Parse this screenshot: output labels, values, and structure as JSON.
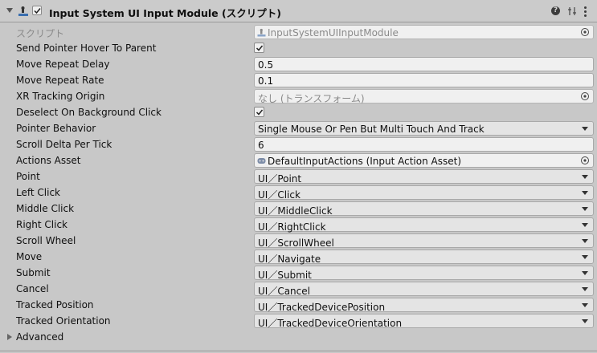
{
  "header": {
    "title": "Input System UI Input Module (スクリプト)",
    "enabled": true,
    "help_glyph": "?",
    "icons": [
      "component-icon",
      "help-icon",
      "preset-icon",
      "kebab-menu-icon"
    ]
  },
  "rows": [
    {
      "label": "スクリプト",
      "kind": "script",
      "value": "InputSystemUIInputModule"
    },
    {
      "label": "Send Pointer Hover To Parent",
      "kind": "toggle",
      "checked": true
    },
    {
      "label": "Move Repeat Delay",
      "kind": "text",
      "value": "0.5"
    },
    {
      "label": "Move Repeat Rate",
      "kind": "text",
      "value": "0.1"
    },
    {
      "label": "XR Tracking Origin",
      "kind": "object",
      "value": "なし (トランスフォーム)"
    },
    {
      "label": "Deselect On Background Click",
      "kind": "toggle",
      "checked": true
    },
    {
      "label": "Pointer Behavior",
      "kind": "popup",
      "value": "Single Mouse Or Pen But Multi Touch And Track"
    },
    {
      "label": "Scroll Delta Per Tick",
      "kind": "text",
      "value": "6"
    },
    {
      "label": "Actions Asset",
      "kind": "asset",
      "value": "DefaultInputActions (Input Action Asset)"
    },
    {
      "label": "Point",
      "kind": "popup",
      "value": "UI／Point"
    },
    {
      "label": "Left Click",
      "kind": "popup",
      "value": "UI／Click"
    },
    {
      "label": "Middle Click",
      "kind": "popup",
      "value": "UI／MiddleClick"
    },
    {
      "label": "Right Click",
      "kind": "popup",
      "value": "UI／RightClick"
    },
    {
      "label": "Scroll Wheel",
      "kind": "popup",
      "value": "UI／ScrollWheel"
    },
    {
      "label": "Move",
      "kind": "popup",
      "value": "UI／Navigate"
    },
    {
      "label": "Submit",
      "kind": "popup",
      "value": "UI／Submit"
    },
    {
      "label": "Cancel",
      "kind": "popup",
      "value": "UI／Cancel"
    },
    {
      "label": "Tracked Position",
      "kind": "popup",
      "value": "UI／TrackedDevicePosition"
    },
    {
      "label": "Tracked Orientation",
      "kind": "popup",
      "value": "UI／TrackedDeviceOrientation"
    }
  ],
  "advanced": {
    "label": "Advanced",
    "expanded": false
  }
}
